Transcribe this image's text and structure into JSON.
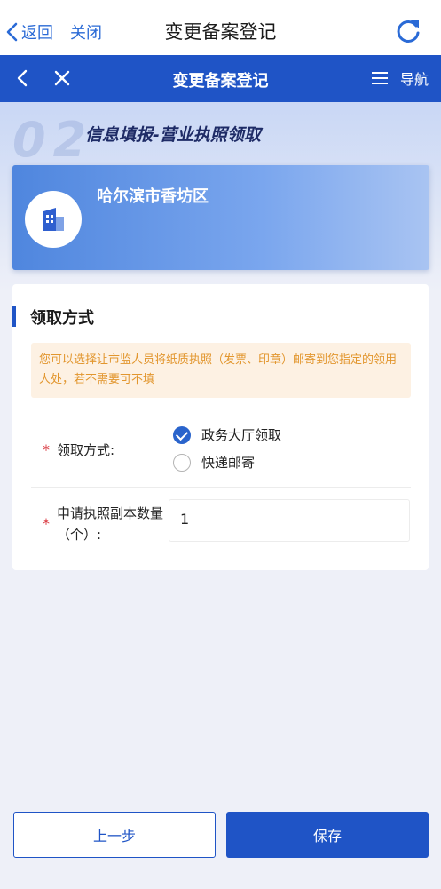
{
  "top_bar": {
    "back_label": "返回",
    "close_label": "关闭",
    "title": "变更备案登记"
  },
  "blue_bar": {
    "title": "变更备案登记",
    "nav_label": "导航"
  },
  "step": {
    "number": "02",
    "title": "信息填报-营业执照领取"
  },
  "region": {
    "name": "哈尔滨市香坊区"
  },
  "section": {
    "title": "领取方式",
    "notice": "您可以选择让市监人员将纸质执照（发票、印章）邮寄到您指定的领用人处，若不需要可不填"
  },
  "form": {
    "required_mark": "*",
    "mode_label": "领取方式:",
    "options": [
      {
        "label": "政务大厅领取",
        "selected": true
      },
      {
        "label": "快递邮寄",
        "selected": false
      }
    ],
    "qty_label": "申请执照副本数量（个）:",
    "qty_value": "1"
  },
  "buttons": {
    "prev": "上一步",
    "save": "保存"
  },
  "colors": {
    "primary": "#1f54c6",
    "notice_text": "#e2962e",
    "notice_bg": "#fdf1e3",
    "required": "#d9363e"
  }
}
